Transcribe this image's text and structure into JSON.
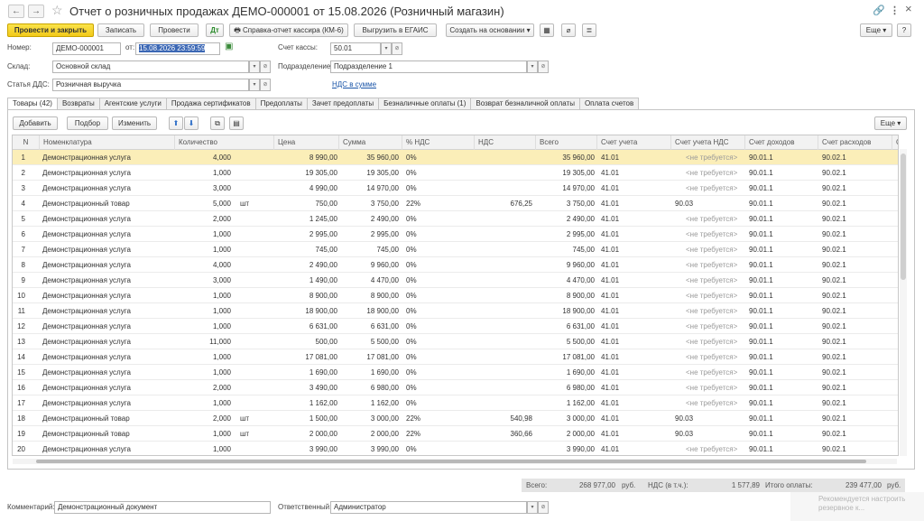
{
  "window": {
    "title": "Отчет о розничных продажах ДЕМО-000001 от 15.08.2026 (Розничный магазин)",
    "back": "←",
    "forward": "→",
    "star": "☆",
    "link_icon": "🔗",
    "menu_icon": "⋮",
    "close_icon": "×"
  },
  "toolbar": {
    "post_close": "Провести и закрыть",
    "save": "Записать",
    "post": "Провести",
    "km6": "Справка-отчет кассира (КМ-6)",
    "egais": "Выгрузить в ЕГАИС",
    "create_based": "Создать на основании",
    "more": "Еще",
    "more_arrow": "▾",
    "help": "?"
  },
  "form": {
    "number_label": "Номер:",
    "number": "ДЕМО-000001",
    "date_label": "от:",
    "date": "15.08.2026 23:59:59",
    "cash_label": "Счет кассы:",
    "cash": "50.01",
    "warehouse_label": "Склад:",
    "warehouse": "Основной склад",
    "division_label": "Подразделение:",
    "division": "Подразделение 1",
    "dds_label": "Статья ДДС:",
    "dds": "Розничная выручка",
    "vat_link": "НДС в сумме",
    "dd_arrow": "▾",
    "open_icon": "⊘"
  },
  "tabs": [
    "Товары (42)",
    "Возвраты",
    "Агентские услуги",
    "Продажа сертификатов",
    "Предоплаты",
    "Зачет предоплаты",
    "Безналичные оплаты (1)",
    "Возврат безналичной оплаты",
    "Оплата счетов"
  ],
  "table_toolbar": {
    "add": "Добавить",
    "select": "Подбор",
    "change": "Изменить",
    "up": "⬆",
    "down": "⬇",
    "more": "Еще"
  },
  "columns": [
    "N",
    "Номенклатура",
    "Количество",
    "Цена",
    "Сумма",
    "% НДС",
    "НДС",
    "Всего",
    "Счет учета",
    "Счет учета НДС",
    "Счет доходов",
    "Счет расходов",
    "С"
  ],
  "rows": [
    [
      "1",
      "Демонстрационная услуга",
      "4,000",
      "",
      "8 990,00",
      "35 960,00",
      "0%",
      "",
      "35 960,00",
      "41.01",
      "<не требуется>",
      "90.01.1",
      "90.02.1"
    ],
    [
      "2",
      "Демонстрационная услуга",
      "1,000",
      "",
      "19 305,00",
      "19 305,00",
      "0%",
      "",
      "19 305,00",
      "41.01",
      "<не требуется>",
      "90.01.1",
      "90.02.1"
    ],
    [
      "3",
      "Демонстрационная услуга",
      "3,000",
      "",
      "4 990,00",
      "14 970,00",
      "0%",
      "",
      "14 970,00",
      "41.01",
      "<не требуется>",
      "90.01.1",
      "90.02.1"
    ],
    [
      "4",
      "Демонстрационный товар",
      "5,000",
      "шт",
      "750,00",
      "3 750,00",
      "22%",
      "676,25",
      "3 750,00",
      "41.01",
      "90.03",
      "90.01.1",
      "90.02.1"
    ],
    [
      "5",
      "Демонстрационная услуга",
      "2,000",
      "",
      "1 245,00",
      "2 490,00",
      "0%",
      "",
      "2 490,00",
      "41.01",
      "<не требуется>",
      "90.01.1",
      "90.02.1"
    ],
    [
      "6",
      "Демонстрационная услуга",
      "1,000",
      "",
      "2 995,00",
      "2 995,00",
      "0%",
      "",
      "2 995,00",
      "41.01",
      "<не требуется>",
      "90.01.1",
      "90.02.1"
    ],
    [
      "7",
      "Демонстрационная услуга",
      "1,000",
      "",
      "745,00",
      "745,00",
      "0%",
      "",
      "745,00",
      "41.01",
      "<не требуется>",
      "90.01.1",
      "90.02.1"
    ],
    [
      "8",
      "Демонстрационная услуга",
      "4,000",
      "",
      "2 490,00",
      "9 960,00",
      "0%",
      "",
      "9 960,00",
      "41.01",
      "<не требуется>",
      "90.01.1",
      "90.02.1"
    ],
    [
      "9",
      "Демонстрационная услуга",
      "3,000",
      "",
      "1 490,00",
      "4 470,00",
      "0%",
      "",
      "4 470,00",
      "41.01",
      "<не требуется>",
      "90.01.1",
      "90.02.1"
    ],
    [
      "10",
      "Демонстрационная услуга",
      "1,000",
      "",
      "8 900,00",
      "8 900,00",
      "0%",
      "",
      "8 900,00",
      "41.01",
      "<не требуется>",
      "90.01.1",
      "90.02.1"
    ],
    [
      "11",
      "Демонстрационная услуга",
      "1,000",
      "",
      "18 900,00",
      "18 900,00",
      "0%",
      "",
      "18 900,00",
      "41.01",
      "<не требуется>",
      "90.01.1",
      "90.02.1"
    ],
    [
      "12",
      "Демонстрационная услуга",
      "1,000",
      "",
      "6 631,00",
      "6 631,00",
      "0%",
      "",
      "6 631,00",
      "41.01",
      "<не требуется>",
      "90.01.1",
      "90.02.1"
    ],
    [
      "13",
      "Демонстрационная услуга",
      "11,000",
      "",
      "500,00",
      "5 500,00",
      "0%",
      "",
      "5 500,00",
      "41.01",
      "<не требуется>",
      "90.01.1",
      "90.02.1"
    ],
    [
      "14",
      "Демонстрационная услуга",
      "1,000",
      "",
      "17 081,00",
      "17 081,00",
      "0%",
      "",
      "17 081,00",
      "41.01",
      "<не требуется>",
      "90.01.1",
      "90.02.1"
    ],
    [
      "15",
      "Демонстрационная услуга",
      "1,000",
      "",
      "1 690,00",
      "1 690,00",
      "0%",
      "",
      "1 690,00",
      "41.01",
      "<не требуется>",
      "90.01.1",
      "90.02.1"
    ],
    [
      "16",
      "Демонстрационная услуга",
      "2,000",
      "",
      "3 490,00",
      "6 980,00",
      "0%",
      "",
      "6 980,00",
      "41.01",
      "<не требуется>",
      "90.01.1",
      "90.02.1"
    ],
    [
      "17",
      "Демонстрационная услуга",
      "1,000",
      "",
      "1 162,00",
      "1 162,00",
      "0%",
      "",
      "1 162,00",
      "41.01",
      "<не требуется>",
      "90.01.1",
      "90.02.1"
    ],
    [
      "18",
      "Демонстрационный товар",
      "2,000",
      "шт",
      "1 500,00",
      "3 000,00",
      "22%",
      "540,98",
      "3 000,00",
      "41.01",
      "90.03",
      "90.01.1",
      "90.02.1"
    ],
    [
      "19",
      "Демонстрационный товар",
      "1,000",
      "шт",
      "2 000,00",
      "2 000,00",
      "22%",
      "360,66",
      "2 000,00",
      "41.01",
      "90.03",
      "90.01.1",
      "90.02.1"
    ],
    [
      "20",
      "Демонстрационная услуга",
      "1,000",
      "",
      "3 990,00",
      "3 990,00",
      "0%",
      "",
      "3 990,00",
      "41.01",
      "<не требуется>",
      "90.01.1",
      "90.02.1"
    ]
  ],
  "totals": {
    "total_label": "Всего:",
    "total": "268 977,00",
    "currency": "руб.",
    "vat_label": "НДС (в т.ч.):",
    "vat": "1 577,89",
    "paid_label": "Итого оплаты:",
    "paid": "239 477,00",
    "currency2": "руб."
  },
  "footer": {
    "comment_label": "Комментарий:",
    "comment": "Демонстрационный документ",
    "resp_label": "Ответственный:",
    "resp": "Администратор",
    "watermark": "Рекомендуется настроить резервное к..."
  }
}
